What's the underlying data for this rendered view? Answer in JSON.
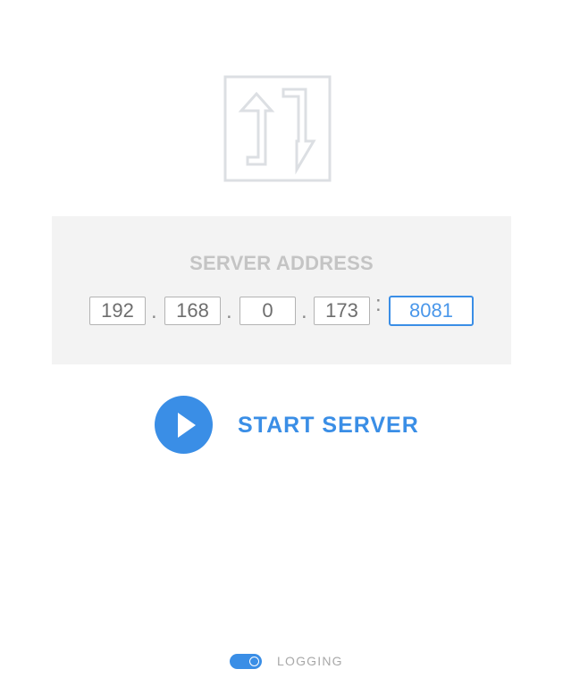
{
  "logo": {
    "icon": "transfer-arrows-icon"
  },
  "server_address": {
    "title": "SERVER ADDRESS",
    "octets": [
      "192",
      "168",
      "0",
      "173"
    ],
    "dot_separator": ".",
    "port_separator": ":",
    "port": "8081"
  },
  "start_server": {
    "icon": "play-icon",
    "label": "START SERVER"
  },
  "logging": {
    "label": "LOGGING",
    "enabled": true
  },
  "colors": {
    "accent": "#3a8ee6",
    "panel_bg": "#f3f3f3",
    "muted_text": "#c4c4c4"
  }
}
